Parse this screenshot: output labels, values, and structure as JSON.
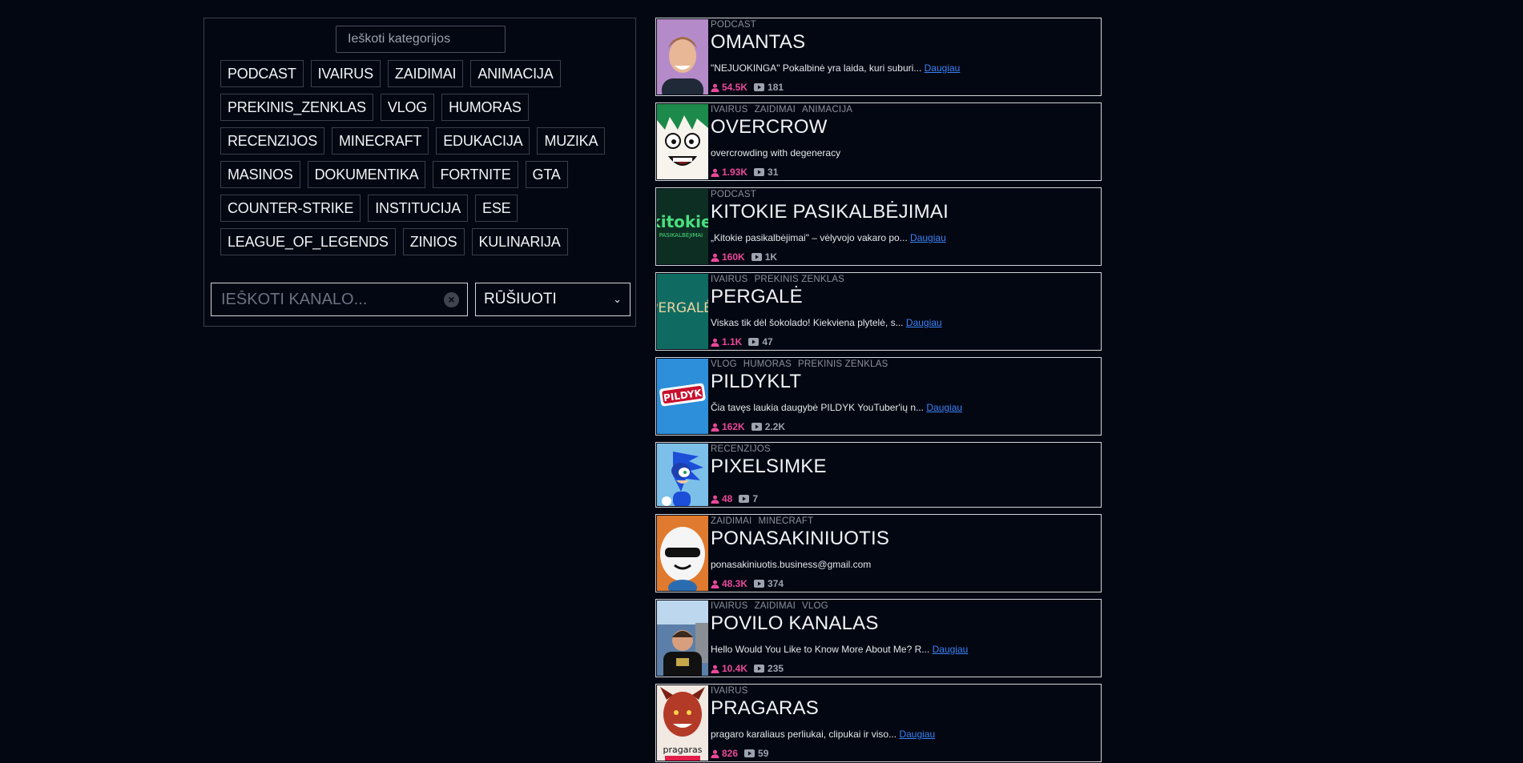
{
  "filters": {
    "category_search_placeholder": "Ieškoti kategorijos",
    "categories": [
      "PODCAST",
      "IVAIRUS",
      "ZAIDIMAI",
      "ANIMACIJA",
      "PREKINIS_ZENKLAS",
      "VLOG",
      "HUMORAS",
      "RECENZIJOS",
      "MINECRAFT",
      "EDUKACIJA",
      "MUZIKA",
      "MASINOS",
      "DOKUMENTIKA",
      "FORTNITE",
      "GTA",
      "COUNTER-STRIKE",
      "INSTITUCIJA",
      "ESE",
      "LEAGUE_OF_LEGENDS",
      "ZINIOS",
      "KULINARIJA"
    ],
    "channel_search_placeholder": "IEŠKOTI KANALO...",
    "sort_label": "RŪŠIUOTI"
  },
  "more_label": "Daugiau",
  "channels": [
    {
      "tags": [
        "PODCAST"
      ],
      "name": "OMANTAS",
      "desc": "\"NEJUOKINGA\" Pokalbinė yra laida, kuri suburi...",
      "more": true,
      "subs": "54.5K",
      "videos": "181",
      "thumb": "portrait",
      "thumb_bg": "#b58ac9"
    },
    {
      "tags": [
        "IVAIRUS",
        "ZAIDIMAI",
        "ANIMACIJA"
      ],
      "name": "OVERCROW",
      "desc": "overcrowding with degeneracy",
      "more": false,
      "subs": "1.93K",
      "videos": "31",
      "thumb": "anime",
      "thumb_bg": "#1c8a4a"
    },
    {
      "tags": [
        "PODCAST"
      ],
      "name": "KITOKIE PASIKALBĖJIMAI",
      "desc": "„Kitokie pasikalbėjimai\" – vėlyvojo vakaro po...",
      "more": true,
      "subs": "160K",
      "videos": "1K",
      "thumb": "text",
      "thumb_text": "kitokie",
      "thumb_sub": "PASIKALBĖJIMAI",
      "thumb_bg": "#0d2e22",
      "thumb_color": "#4ade80"
    },
    {
      "tags": [
        "IVAIRUS",
        "PREKINIS ZENKLAS"
      ],
      "name": "PERGALĖ",
      "desc": "Viskas tik dėl šokolado! Kiekviena plytelė, s...",
      "more": true,
      "subs": "1.1K",
      "videos": "47",
      "thumb": "text",
      "thumb_text": "PERGALĖ",
      "thumb_sub": "",
      "thumb_bg": "#0f6b62",
      "thumb_color": "#e8d2a0"
    },
    {
      "tags": [
        "VLOG",
        "HUMORAS",
        "PREKINIS ZENKLAS"
      ],
      "name": "PILDYKLT",
      "desc": "Čia tavęs laukia daugybė PILDYK YouTuber'ių n...",
      "more": true,
      "subs": "162K",
      "videos": "2.2K",
      "thumb": "pildyk",
      "thumb_text": "PILDYK",
      "thumb_bg": "#2d8fd9"
    },
    {
      "tags": [
        "RECENZIJOS"
      ],
      "name": "PIXELSIMKE",
      "desc": "",
      "more": false,
      "subs": "48",
      "videos": "7",
      "thumb": "sonic",
      "thumb_bg": "#7cc0ea"
    },
    {
      "tags": [
        "ZAIDIMAI",
        "MINECRAFT"
      ],
      "name": "PONASAKINIUOTIS",
      "desc": "ponasakiniuotis.business@gmail.com",
      "more": false,
      "subs": "48.3K",
      "videos": "374",
      "thumb": "shades",
      "thumb_bg": "#e07a2e"
    },
    {
      "tags": [
        "IVAIRUS",
        "ZAIDIMAI",
        "VLOG"
      ],
      "name": "POVILO KANALAS",
      "desc": "Hello Would You Like to Know More About Me? R...",
      "more": true,
      "subs": "10.4K",
      "videos": "235",
      "thumb": "man",
      "thumb_bg": "#5b7fa8"
    },
    {
      "tags": [
        "IVAIRUS"
      ],
      "name": "PRAGARAS",
      "desc": "pragaro karaliaus perliukai, clipukai ir viso...",
      "more": true,
      "subs": "826",
      "videos": "59",
      "thumb": "demon",
      "thumb_text": "pragaras",
      "thumb_bg": "#f1e9e2"
    }
  ]
}
